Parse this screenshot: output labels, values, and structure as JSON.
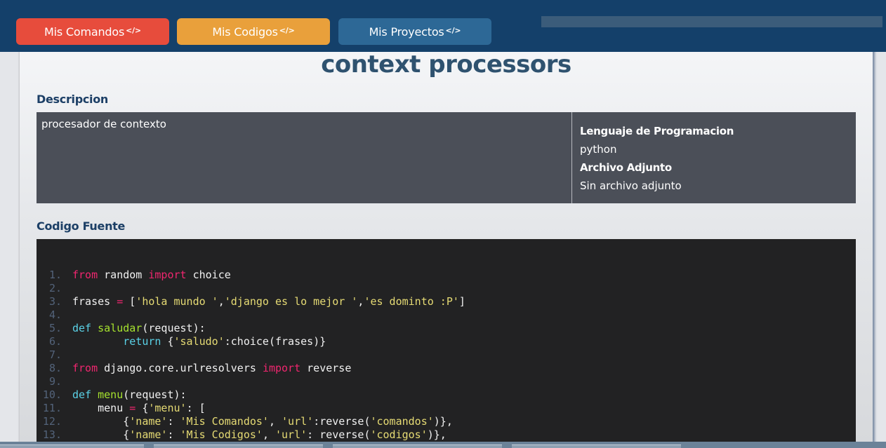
{
  "nav": {
    "comandos": "Mis Comandos",
    "codigos": "Mis Codigos",
    "proyectos": "Mis Proyectos",
    "code_glyph": "</>"
  },
  "page": {
    "title": "context processors",
    "descripcion_label": "Descripcion",
    "descripcion": "procesador de contexto",
    "lenguaje_label": "Lenguaje de Programacion",
    "lenguaje": "python",
    "adjunto_label": "Archivo Adjunto",
    "adjunto": "Sin archivo adjunto",
    "codigo_label": "Codigo Fuente"
  },
  "code_lines": [
    {
      "n": "1.",
      "t": "from random import choice"
    },
    {
      "n": "2.",
      "t": ""
    },
    {
      "n": "3.",
      "t": "frases = ['hola mundo ','django es lo mejor ','es dominto :P']"
    },
    {
      "n": "4.",
      "t": ""
    },
    {
      "n": "5.",
      "t": "def saludar(request):"
    },
    {
      "n": "6.",
      "t": "        return {'saludo':choice(frases)}"
    },
    {
      "n": "7.",
      "t": ""
    },
    {
      "n": "8.",
      "t": "from django.core.urlresolvers import reverse"
    },
    {
      "n": "9.",
      "t": ""
    },
    {
      "n": "10.",
      "t": "def menu(request):"
    },
    {
      "n": "11.",
      "t": "    menu = {'menu': ["
    },
    {
      "n": "12.",
      "t": "        {'name': 'Mis Comandos', 'url':reverse('comandos')},"
    },
    {
      "n": "13.",
      "t": "        {'name': 'Mis Codigos', 'url': reverse('codigos')},"
    }
  ],
  "colors": {
    "navbar": "#14406a",
    "comandos": "#e74c3c",
    "codigos": "#e9a03b",
    "proyectos": "#2d6896",
    "code_bg": "#222223"
  }
}
